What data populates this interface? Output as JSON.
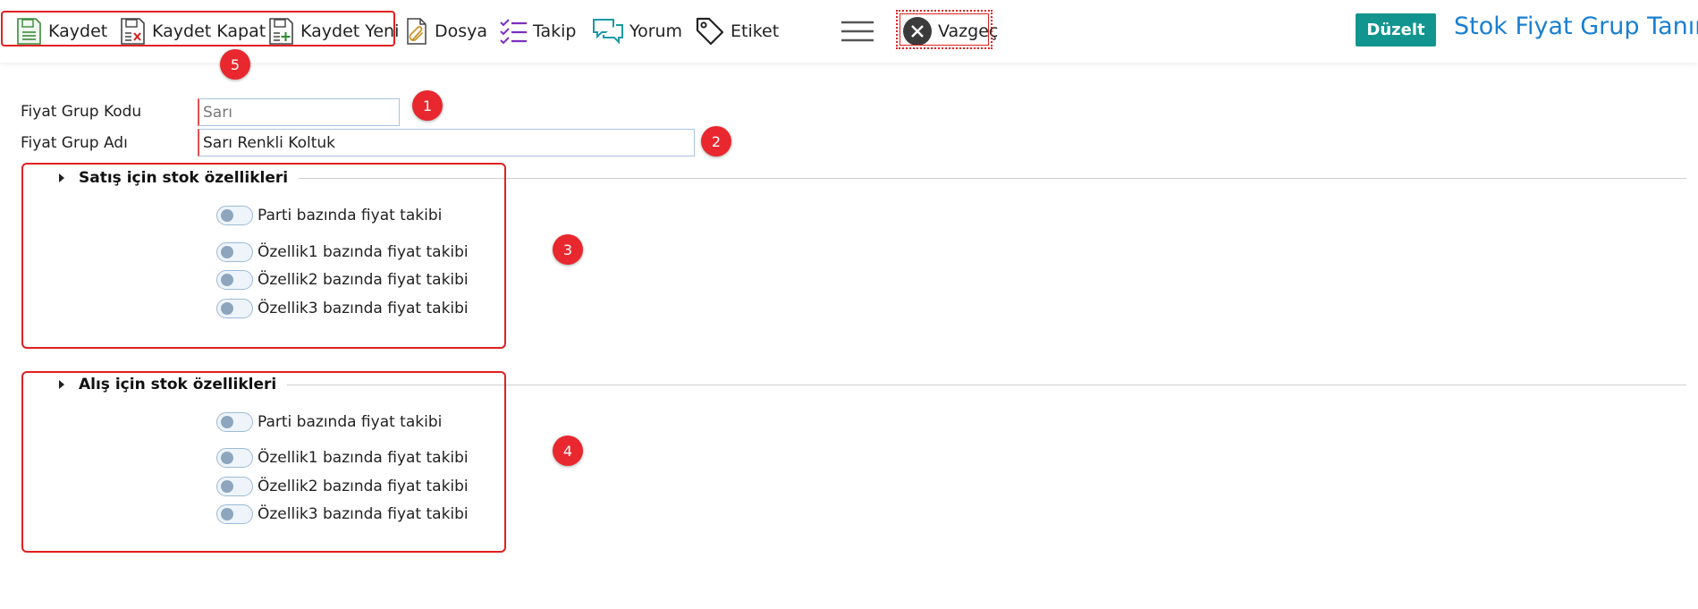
{
  "toolbar": {
    "kaydet": "Kaydet",
    "kaydet_kapat": "Kaydet Kapat",
    "kaydet_yeni": "Kaydet Yeni",
    "dosya": "Dosya",
    "takip": "Takip",
    "yorum": "Yorum",
    "etiket": "Etiket",
    "vazgec": "Vazgeç"
  },
  "header": {
    "edit_button": "Düzelt",
    "title": "Stok Fiyat Grup Tanım"
  },
  "form": {
    "code_label": "Fiyat Grup Kodu",
    "code_value": "Sarı",
    "name_label": "Fiyat Grup Adı",
    "name_value": "Sarı Renkli Koltuk"
  },
  "sales_section": {
    "title": "Satış için stok özellikleri",
    "toggles": [
      {
        "label": "Parti bazında fiyat takibi",
        "on": false
      },
      {
        "label": "Özellik1 bazında fiyat takibi",
        "on": false
      },
      {
        "label": "Özellik2 bazında fiyat takibi",
        "on": false
      },
      {
        "label": "Özellik3 bazında fiyat takibi",
        "on": false
      }
    ]
  },
  "purchase_section": {
    "title": "Alış için stok özellikleri",
    "toggles": [
      {
        "label": "Parti bazında fiyat takibi",
        "on": false
      },
      {
        "label": "Özellik1 bazında fiyat takibi",
        "on": false
      },
      {
        "label": "Özellik2 bazında fiyat takibi",
        "on": false
      },
      {
        "label": "Özellik3 bazında fiyat takibi",
        "on": false
      }
    ]
  },
  "badges": [
    "1",
    "2",
    "3",
    "4",
    "5"
  ],
  "colors": {
    "accent_teal": "#12958f",
    "title_blue": "#1a7fd0",
    "highlight_red": "#e02020",
    "badge_red": "#e8282e"
  },
  "icons": [
    "save-icon",
    "save-close-icon",
    "save-new-icon",
    "paperclip-icon",
    "checklist-icon",
    "comments-icon",
    "tag-icon",
    "hamburger-menu-icon",
    "close-circle-icon"
  ]
}
